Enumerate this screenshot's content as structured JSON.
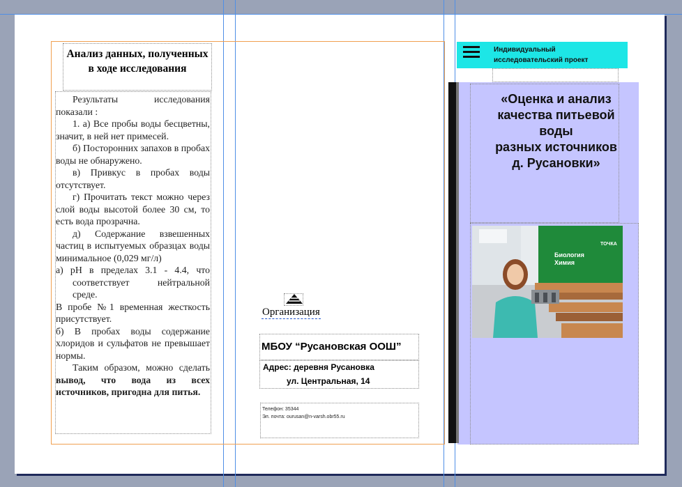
{
  "left_panel": {
    "title": "Анализ данных, полученных в ходе исследования",
    "paragraphs": [
      "Результаты исследования показали :",
      "1. а) Все пробы воды бесцветны, значит, в ней нет примесей.",
      "б) Посторонних запахов в пробах воды не обнаружено.",
      "в) Привкус в пробах воды отсутствует.",
      "г) Прочитать текст можно через слой воды высотой более 30 см, то есть вода прозрачна.",
      "д) Содержание взвешенных частиц в испытуемых образцах воды минимальное (0,029 мг/л)",
      "а) рН в пределах 3.1 - 4.4, что соответствует нейтральной среде.",
      "В пробе №1 временная жесткость присутствует.",
      "б) В пробах воды содержание хлоридов и сульфатов не превышает нормы."
    ],
    "conclusion_before": "Таким образом,  можно сделать ",
    "conclusion_bold": "вывод",
    "conclusion_after": ", что вода из всех источников, пригодна для питья."
  },
  "middle_panel": {
    "org_label": "Организация",
    "org_name": "МБОУ “Русановская ООШ”",
    "address_line1": "Адрес: деревня Русановка",
    "address_line2": "ул. Центральная, 14",
    "phone": "Телефон: 35344",
    "email": "Эл. почта: ourusan@n-varsh.obr55.ru"
  },
  "right_panel": {
    "header": "Индивидуальный исследовательский проект",
    "title_lines": [
      "«Оценка и анализ",
      "качества питьевой",
      "воды",
      "разных источников",
      "д. Русановки»"
    ],
    "photo_board_text": [
      "Биология",
      "Химия"
    ],
    "photo_brand": "ТОЧКА"
  },
  "colors": {
    "cyan": "#1de6e6",
    "purple": "#c5c5ff",
    "frame_orange": "#f0a050",
    "guide_blue": "#4f8fe6"
  }
}
